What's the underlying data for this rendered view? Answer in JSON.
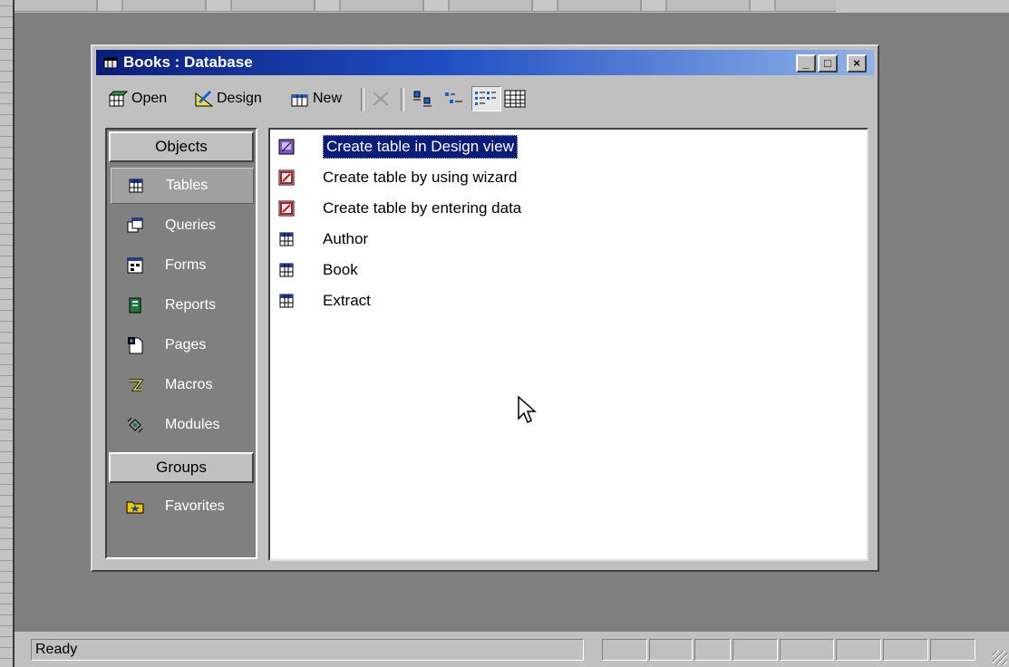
{
  "window": {
    "title": "Books : Database",
    "controls": {
      "minimize": "_",
      "maximize": "□",
      "close": "×"
    }
  },
  "toolbar": {
    "open_label": "Open",
    "design_label": "Design",
    "new_label": "New",
    "buttons": [
      "open",
      "design",
      "new",
      "delete-icon",
      "large-icons-icon",
      "small-icons-icon",
      "list-view-icon",
      "details-view-icon"
    ]
  },
  "objects_bar": {
    "objects_header": "Objects",
    "items": [
      {
        "label": "Tables",
        "icon": "table-icon",
        "selected": true
      },
      {
        "label": "Queries",
        "icon": "query-icon"
      },
      {
        "label": "Forms",
        "icon": "form-icon"
      },
      {
        "label": "Reports",
        "icon": "report-icon"
      },
      {
        "label": "Pages",
        "icon": "page-icon"
      },
      {
        "label": "Macros",
        "icon": "macro-icon"
      },
      {
        "label": "Modules",
        "icon": "module-icon"
      }
    ],
    "groups_header": "Groups",
    "groups": [
      {
        "label": "Favorites",
        "icon": "favorites-folder-icon"
      }
    ]
  },
  "list": {
    "items": [
      {
        "label": "Create table in Design view",
        "icon": "design-wizard-icon",
        "selected": true
      },
      {
        "label": "Create table by using wizard",
        "icon": "wizard-icon"
      },
      {
        "label": "Create table by entering data",
        "icon": "wizard-icon"
      },
      {
        "label": "Author",
        "icon": "table-icon"
      },
      {
        "label": "Book",
        "icon": "table-icon"
      },
      {
        "label": "Extract",
        "icon": "table-icon"
      }
    ]
  },
  "status": {
    "text": "Ready"
  },
  "colors": {
    "titlebar_start": "#0a1d7a",
    "titlebar_end": "#8fb3e8",
    "selection": "#0a1d7a",
    "workspace": "#7f7f7f",
    "face": "#c0c0c0"
  }
}
